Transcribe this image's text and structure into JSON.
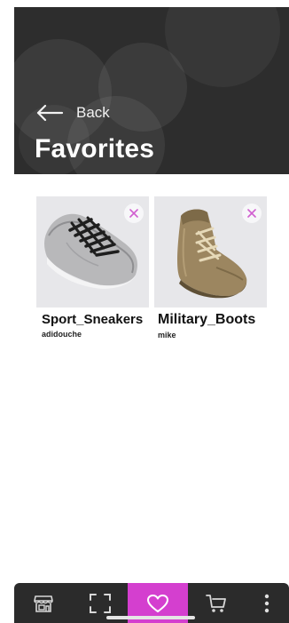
{
  "header": {
    "back_label": "Back",
    "title": "Favorites"
  },
  "favorites": [
    {
      "name": "Sport_Sneakers",
      "seller": "adidouche",
      "image": "sneaker-image"
    },
    {
      "name": "Military_Boots",
      "seller": "mike",
      "image": "boot-image"
    }
  ],
  "nav": {
    "items": [
      {
        "icon": "store-icon",
        "active": false
      },
      {
        "icon": "scan-icon",
        "active": false
      },
      {
        "icon": "heart-icon",
        "active": true
      },
      {
        "icon": "cart-icon",
        "active": false
      },
      {
        "icon": "more-vertical-icon",
        "active": false
      }
    ],
    "active_color": "#d43fcf",
    "bar_color": "#2b2b2b"
  },
  "colors": {
    "header_bg": "#2d2d2d",
    "remove_icon": "#d15fd0"
  }
}
